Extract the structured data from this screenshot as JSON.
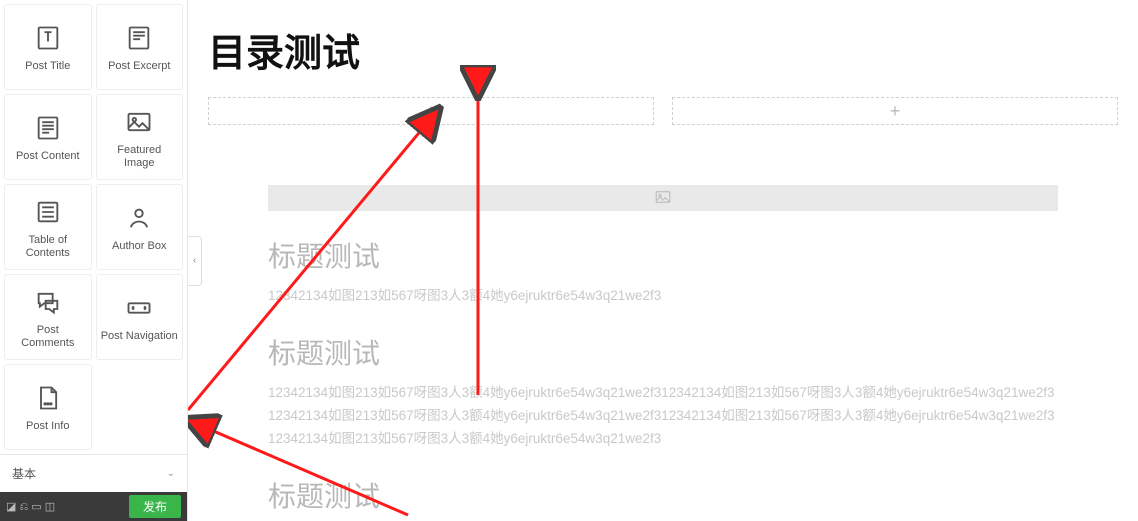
{
  "sidebar": {
    "widgets": [
      {
        "label": "Post Title",
        "icon": "post-title-icon"
      },
      {
        "label": "Post Excerpt",
        "icon": "post-excerpt-icon"
      },
      {
        "label": "Post Content",
        "icon": "post-content-icon"
      },
      {
        "label": "Featured Image",
        "icon": "featured-image-icon"
      },
      {
        "label": "Table of Contents",
        "icon": "toc-icon"
      },
      {
        "label": "Author Box",
        "icon": "author-box-icon"
      },
      {
        "label": "Post Comments",
        "icon": "post-comments-icon"
      },
      {
        "label": "Post Navigation",
        "icon": "post-navigation-icon"
      },
      {
        "label": "Post Info",
        "icon": "post-info-icon"
      }
    ],
    "basic_label": "基本",
    "publish_label": "发布",
    "toolbar_glyphs": "◪ ⎌ ▭ ◫"
  },
  "canvas": {
    "title": "目录测试",
    "dropzone_plus": "+",
    "h2_a": "标题测试",
    "para_a": "12342134如图213如567呀图3人3额4她y6ejruktr6e54w3q21we2f3",
    "h2_b": "标题测试",
    "para_b": "12342134如图213如567呀图3人3额4她y6ejruktr6e54w3q21we2f312342134如图213如567呀图3人3额4她y6ejruktr6e54w3q21we2f312342134如图213如567呀图3人3额4她y6ejruktr6e54w3q21we2f312342134如图213如567呀图3人3额4她y6ejruktr6e54w3q21we2f312342134如图213如567呀图3人3额4她y6ejruktr6e54w3q21we2f3",
    "h2_c": "标题测试"
  }
}
